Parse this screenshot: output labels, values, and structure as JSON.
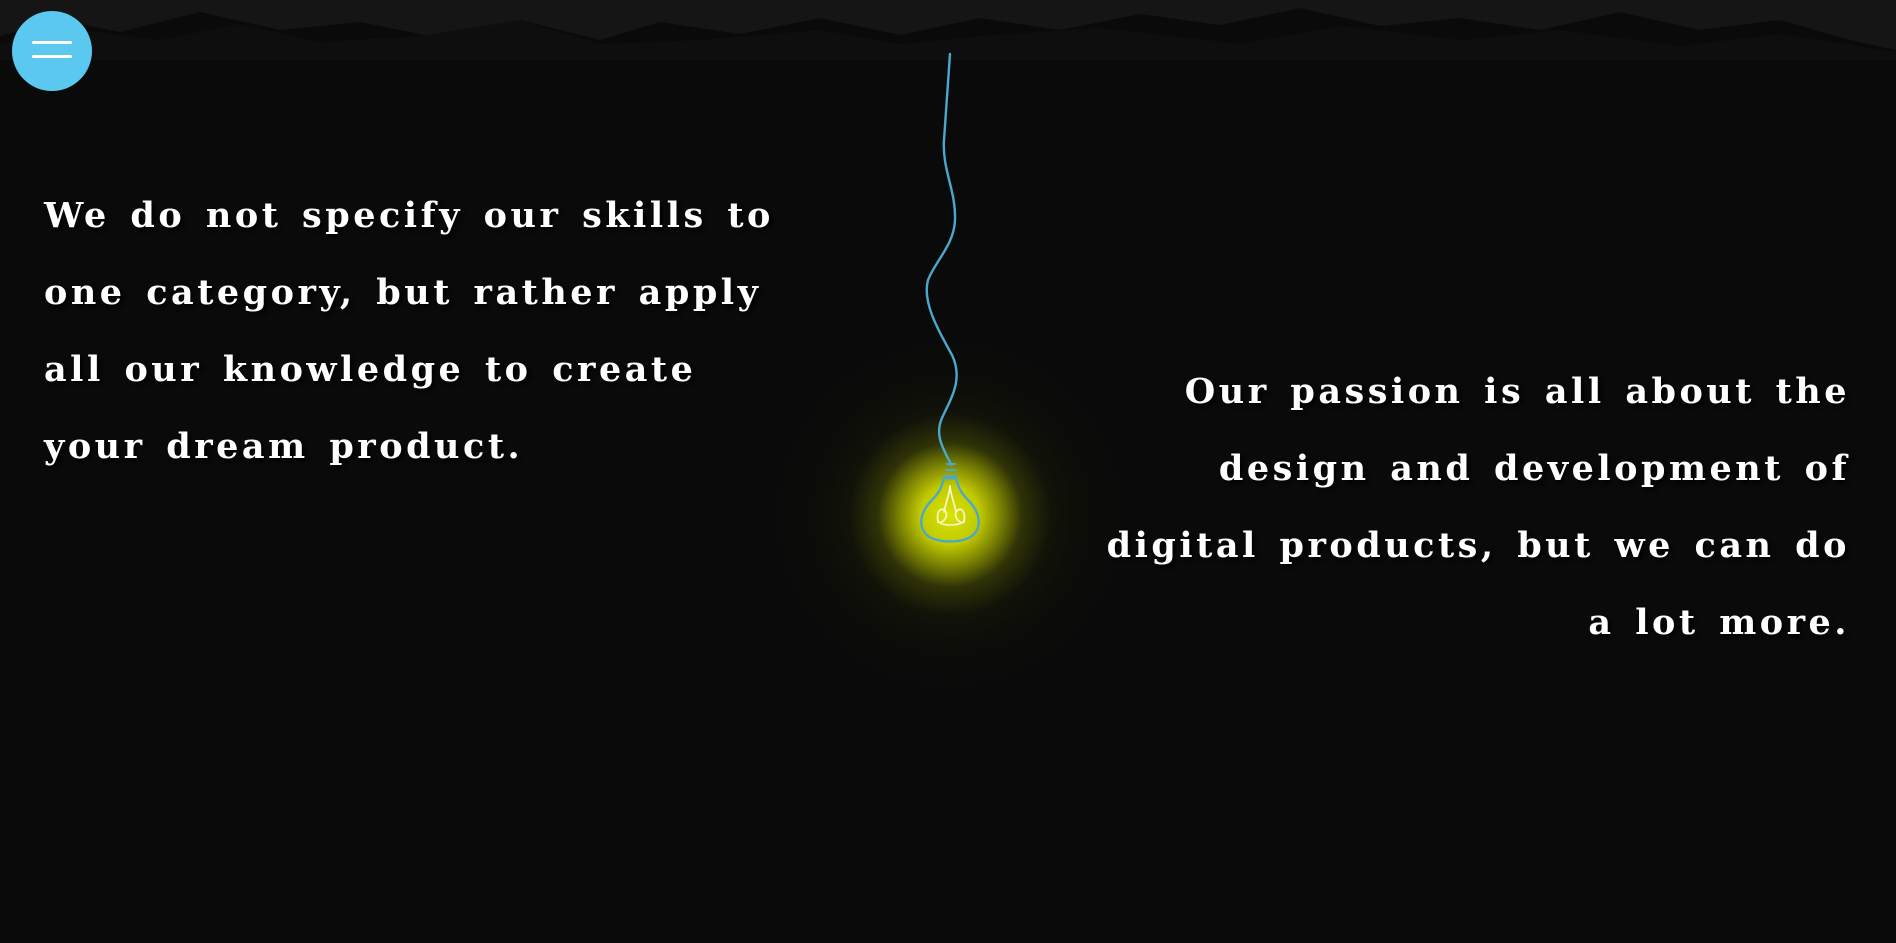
{
  "menu": {
    "icon": "hamburger-icon",
    "color": "#5bc8ef"
  },
  "intro_left": {
    "lines": [
      "We do not specify our skills to",
      "one category, but rather apply",
      "all our knowledge to create",
      "your dream product."
    ]
  },
  "intro_right": {
    "lines": [
      "Our passion is all about the",
      "design and development of",
      "digital products, but we can do",
      "a lot more."
    ]
  },
  "illustration": {
    "icon": "light-bulb-icon",
    "glow_color": "#e0e800",
    "wire_color": "#4aa8cc"
  },
  "colors": {
    "background": "#0a0a0a",
    "text": "#ffffff"
  }
}
